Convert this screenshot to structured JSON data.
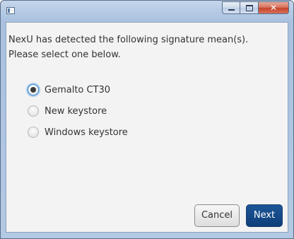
{
  "window": {
    "title": ""
  },
  "caption": {
    "close_glyph": "✕"
  },
  "dialog": {
    "message": "NexU has detected the following signature mean(s). Please select one below.",
    "options": [
      {
        "label": "Gemalto CT30",
        "selected": true
      },
      {
        "label": "New keystore",
        "selected": false
      },
      {
        "label": "Windows keystore",
        "selected": false
      }
    ],
    "cancel_label": "Cancel",
    "next_label": "Next"
  },
  "colors": {
    "primary_button": "#0e3f7a",
    "selection_ring": "#3a83c6"
  }
}
